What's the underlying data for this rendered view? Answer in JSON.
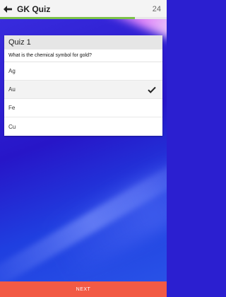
{
  "header": {
    "title": "GK Quiz",
    "count": "24",
    "progress_fraction": 0.81,
    "back_icon": "arrow-back-icon"
  },
  "quiz": {
    "title": "Quiz 1",
    "question": "What is the chemical symbol for gold?",
    "options": [
      {
        "label": "Ag",
        "selected": false
      },
      {
        "label": "Au",
        "selected": true
      },
      {
        "label": "Fe",
        "selected": false
      },
      {
        "label": "Cu",
        "selected": false
      }
    ],
    "check_icon": "checkmark-icon"
  },
  "footer": {
    "next_label": "NEXT"
  },
  "colors": {
    "progress": "#7cc24a",
    "next_button": "#f25a45"
  }
}
